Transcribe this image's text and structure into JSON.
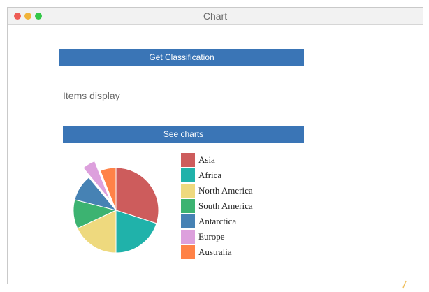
{
  "window": {
    "title": "Chart",
    "controls": {
      "close_color": "#ee5c55",
      "minimize_color": "#f1b43a",
      "maximize_color": "#33c748"
    }
  },
  "main": {
    "classify_button_label": "Get Classification",
    "items_display_text": "Items display",
    "charts_button_label": "See charts"
  },
  "colors": {
    "button_bg": "#3a75b6",
    "button_text": "#ffffff"
  },
  "chart_data": {
    "type": "pie",
    "title": "",
    "series": [
      {
        "name": "Asia",
        "value": 30,
        "color": "#cd5c5c",
        "exploded": false
      },
      {
        "name": "Africa",
        "value": 20,
        "color": "#20b2aa",
        "exploded": false
      },
      {
        "name": "North America",
        "value": 18,
        "color": "#eed97e",
        "exploded": false
      },
      {
        "name": "South America",
        "value": 11,
        "color": "#3cb371",
        "exploded": false
      },
      {
        "name": "Antarctica",
        "value": 10,
        "color": "#4682b4",
        "exploded": false
      },
      {
        "name": "Europe",
        "value": 5,
        "color": "#dda0dd",
        "exploded": true
      },
      {
        "name": "Australia",
        "value": 6,
        "color": "#ff8247",
        "exploded": false
      }
    ],
    "legend_placement": "right"
  }
}
